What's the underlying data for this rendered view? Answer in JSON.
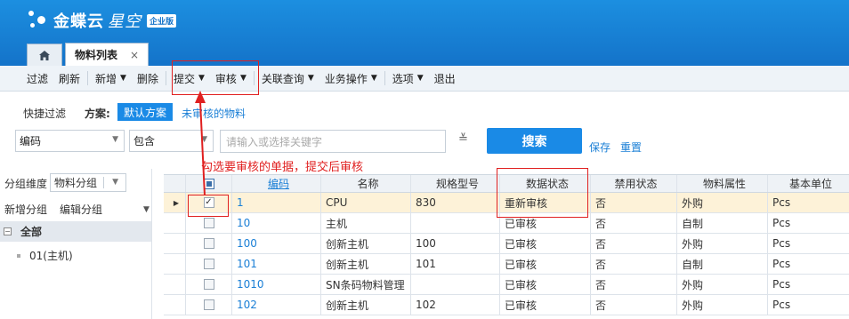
{
  "header": {
    "brand": "金蝶云",
    "product": "星空",
    "edition_badge": "企业版",
    "active_tab": "物料列表",
    "tab_close": "×"
  },
  "toolbar": {
    "items": [
      "过滤",
      "刷新",
      "新增",
      "删除",
      "提交",
      "审核",
      "关联查询",
      "业务操作",
      "选项",
      "退出"
    ]
  },
  "quick_filter": {
    "label": "快捷过滤",
    "plan_label": "方案:",
    "default_plan": "默认方案",
    "unaudited_plan": "未审核的物料"
  },
  "filter": {
    "field": "编码",
    "operator": "包含",
    "value_placeholder": "请输入或选择关键字",
    "search_label": "搜索",
    "save_label": "保存",
    "reset_label": "重置"
  },
  "annotation": {
    "text": "勾选要审核的单据，提交后审核"
  },
  "left_panel": {
    "dimension_label": "分组维度",
    "dimension_value": "物料分组",
    "add_group": "新增分组",
    "edit_group": "编辑分组",
    "tree_root": "全部",
    "tree_child": "01(主机)"
  },
  "grid": {
    "columns": [
      "编码",
      "名称",
      "规格型号",
      "数据状态",
      "禁用状态",
      "物料属性",
      "基本单位"
    ],
    "rows": [
      {
        "checked": true,
        "code": "1",
        "name": "CPU",
        "spec": "830",
        "status": "重新审核",
        "disabled": "否",
        "attr": "外购",
        "unit": "Pcs"
      },
      {
        "checked": false,
        "code": "10",
        "name": "主机",
        "spec": "",
        "status": "已审核",
        "disabled": "否",
        "attr": "自制",
        "unit": "Pcs"
      },
      {
        "checked": false,
        "code": "100",
        "name": "创新主机",
        "spec": "100",
        "status": "已审核",
        "disabled": "否",
        "attr": "外购",
        "unit": "Pcs"
      },
      {
        "checked": false,
        "code": "101",
        "name": "创新主机",
        "spec": "101",
        "status": "已审核",
        "disabled": "否",
        "attr": "自制",
        "unit": "Pcs"
      },
      {
        "checked": false,
        "code": "1010",
        "name": "SN条码物料管理",
        "spec": "",
        "status": "已审核",
        "disabled": "否",
        "attr": "外购",
        "unit": "Pcs"
      },
      {
        "checked": false,
        "code": "102",
        "name": "创新主机",
        "spec": "102",
        "status": "已审核",
        "disabled": "否",
        "attr": "外购",
        "unit": "Pcs"
      }
    ]
  },
  "colors": {
    "header_blue": "#1473c9",
    "accent_blue": "#1a8ae6",
    "annotation_red": "#e02020",
    "selected_row": "#fdf2d8"
  }
}
